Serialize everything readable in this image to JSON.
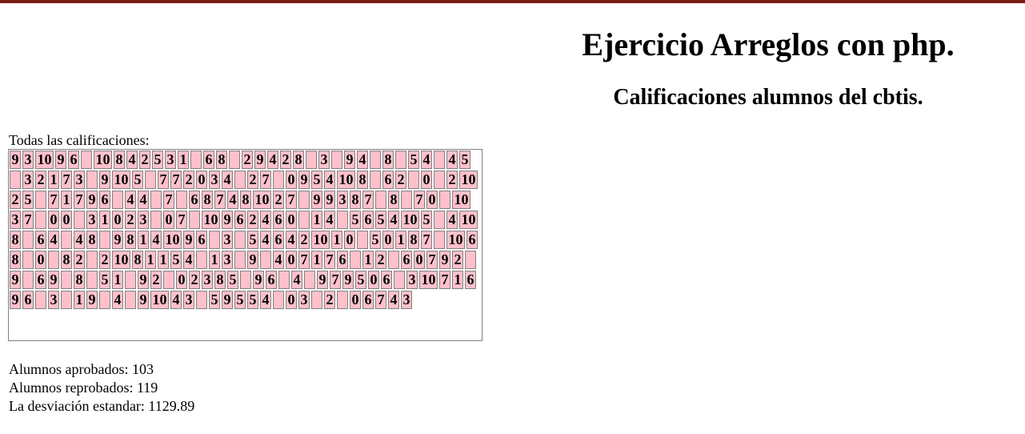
{
  "header": {
    "title": "Ejercicio Arreglos con php.",
    "subtitle": "Calificaciones alumnos del cbtis."
  },
  "grades_label": "Todas las calificaciones:",
  "grades": [
    "9",
    "3",
    "10",
    "9",
    "6",
    "",
    "10",
    "8",
    "4",
    "2",
    "5",
    "3",
    "1",
    "",
    "6",
    "8",
    "",
    "2",
    "9",
    "4",
    "2",
    "8",
    "",
    "3",
    "",
    "9",
    "4",
    "",
    "8",
    "",
    "5",
    "4",
    "",
    "4",
    "5",
    "",
    "3",
    "2",
    "1",
    "7",
    "3",
    "",
    "9",
    "10",
    "5",
    "",
    "7",
    "7",
    "2",
    "0",
    "3",
    "4",
    "",
    "2",
    "7",
    "",
    "0",
    "9",
    "5",
    "4",
    "10",
    "8",
    "",
    "6",
    "2",
    "",
    "0",
    "",
    "2",
    "10",
    "2",
    "5",
    "",
    "7",
    "1",
    "7",
    "9",
    "6",
    "",
    "4",
    "4",
    "",
    "7",
    "",
    "6",
    "8",
    "7",
    "4",
    "8",
    "10",
    "2",
    "7",
    "",
    "9",
    "9",
    "3",
    "8",
    "7",
    "",
    "8",
    "",
    "7",
    "0",
    "",
    "10",
    "3",
    "7",
    "",
    "0",
    "0",
    "",
    "3",
    "1",
    "0",
    "2",
    "3",
    "",
    "0",
    "7",
    "",
    "10",
    "9",
    "6",
    "2",
    "4",
    "6",
    "0",
    "",
    "1",
    "4",
    "",
    "5",
    "6",
    "5",
    "4",
    "10",
    "5",
    "",
    "4",
    "10",
    "8",
    "",
    "6",
    "4",
    "",
    "4",
    "8",
    "",
    "9",
    "8",
    "1",
    "4",
    "10",
    "9",
    "6",
    "",
    "3",
    "",
    "5",
    "4",
    "6",
    "4",
    "2",
    "10",
    "1",
    "0",
    "",
    "5",
    "0",
    "1",
    "8",
    "7",
    "",
    "10",
    "6",
    "8",
    "",
    "0",
    "",
    "8",
    "2",
    "",
    "2",
    "10",
    "8",
    "1",
    "1",
    "5",
    "4",
    "",
    "1",
    "3",
    "",
    "9",
    "",
    "4",
    "0",
    "7",
    "1",
    "7",
    "6",
    "",
    "1",
    "2",
    "",
    "6",
    "0",
    "7",
    "9",
    "2",
    "",
    "9",
    "",
    "6",
    "9",
    "",
    "8",
    "",
    "5",
    "1",
    "",
    "9",
    "2",
    "",
    "0",
    "2",
    "3",
    "8",
    "5",
    "",
    "9",
    "6",
    "",
    "4",
    "",
    "9",
    "7",
    "9",
    "5",
    "0",
    "6",
    "",
    "3",
    "10",
    "7",
    "1",
    "6",
    "9",
    "6",
    "",
    "3",
    "",
    "1",
    "9",
    "",
    "4",
    "",
    "9",
    "10",
    "4",
    "3",
    "",
    "5",
    "9",
    "5",
    "5",
    "4",
    "",
    "0",
    "3",
    "",
    "2",
    "",
    "0",
    "6",
    "7",
    "4",
    "3"
  ],
  "stats": {
    "approved": "Alumnos aprobados: 103",
    "failed": "Alumnos reprobados: 119",
    "std_dev": "La desviación estandar: 1129.89"
  }
}
